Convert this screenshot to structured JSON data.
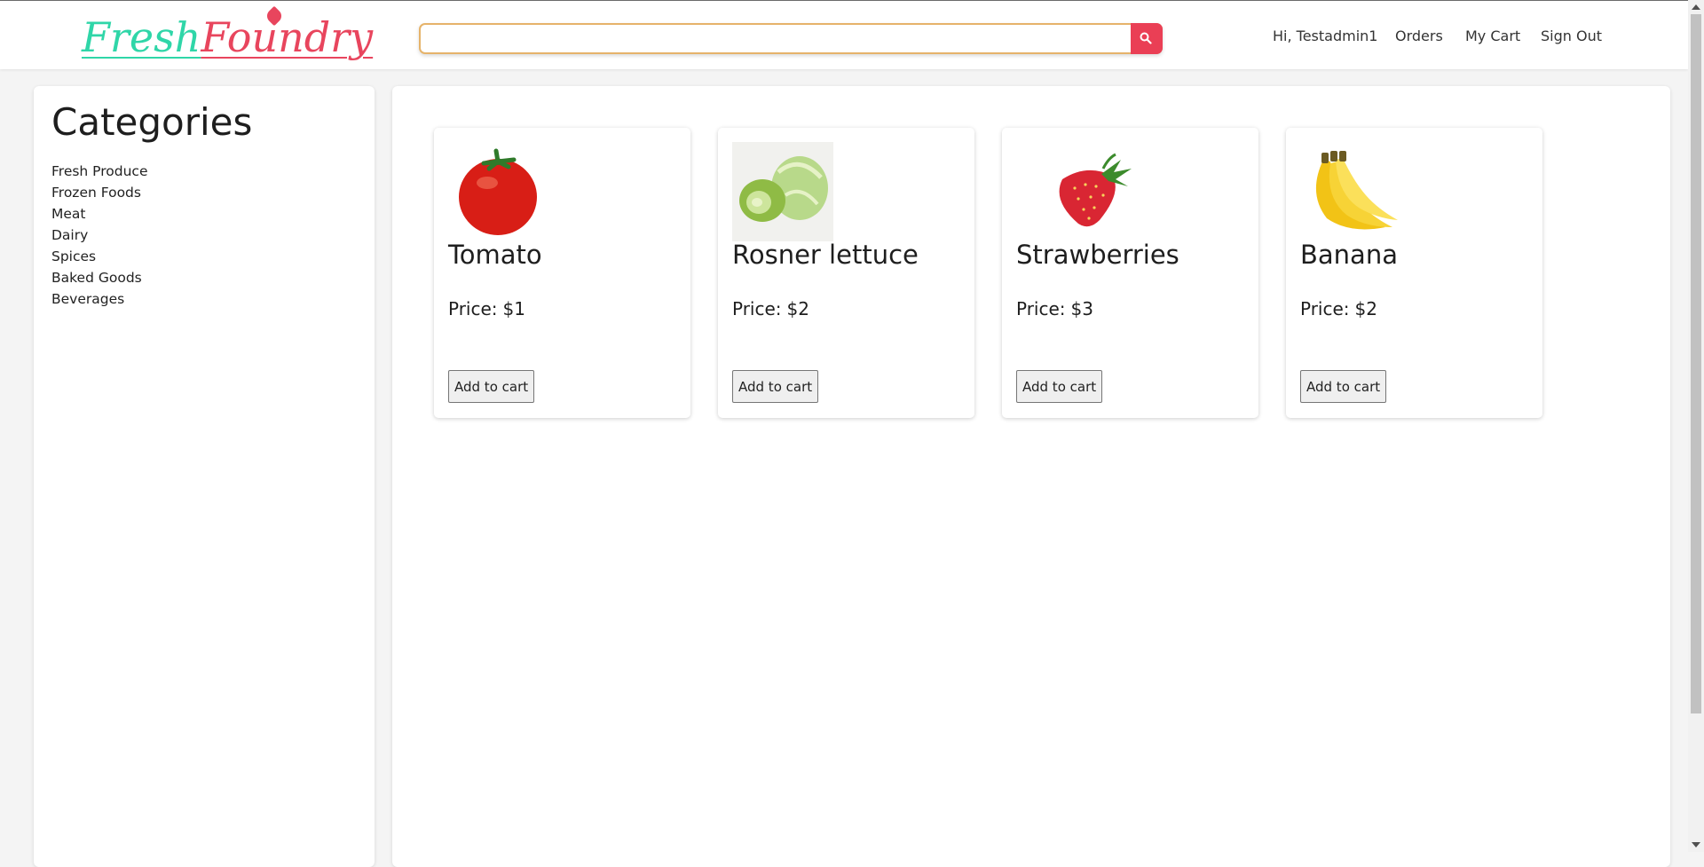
{
  "brand": {
    "part1": "Fresh",
    "part2": "Foundry",
    "color1": "#2fd6a8",
    "color2": "#e8455d",
    "icon": "maple-leaf-icon"
  },
  "search": {
    "value": "",
    "placeholder": "",
    "button_icon": "search-icon",
    "button_color": "#ea3f55"
  },
  "nav": {
    "greeting": "Hi, Testadmin1",
    "orders": "Orders",
    "cart": "My Cart",
    "signout": "Sign Out"
  },
  "sidebar": {
    "title": "Categories",
    "items": [
      {
        "label": "Fresh Produce"
      },
      {
        "label": "Frozen Foods"
      },
      {
        "label": "Meat"
      },
      {
        "label": "Dairy"
      },
      {
        "label": "Spices"
      },
      {
        "label": "Baked Goods"
      },
      {
        "label": "Beverages"
      }
    ]
  },
  "products": [
    {
      "name": "Tomato",
      "price_label": "Price:",
      "price": "$1",
      "button": "Add to cart",
      "image": "tomato-image"
    },
    {
      "name": "Rosner lettuce",
      "price_label": "Price:",
      "price": "$2",
      "button": "Add to cart",
      "image": "lettuce-image"
    },
    {
      "name": "Strawberries",
      "price_label": "Price:",
      "price": "$3",
      "button": "Add to cart",
      "image": "strawberry-image"
    },
    {
      "name": "Banana",
      "price_label": "Price:",
      "price": "$2",
      "button": "Add to cart",
      "image": "banana-image"
    }
  ]
}
